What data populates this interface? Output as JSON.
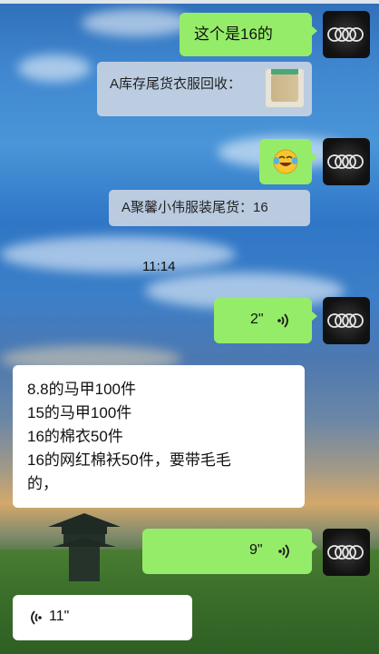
{
  "chat": {
    "messages": [
      {
        "side": "right",
        "type": "text",
        "text": "这个是16的"
      },
      {
        "side": "right",
        "type": "quote",
        "text": "A库存尾货衣服回收："
      },
      {
        "side": "right",
        "type": "emoji",
        "text": ""
      },
      {
        "side": "right",
        "type": "quote",
        "text": "A聚馨小伟服装尾货：16"
      },
      {
        "side": "center",
        "type": "time",
        "text": "11:14"
      },
      {
        "side": "right",
        "type": "voice",
        "text": "2\""
      },
      {
        "side": "left",
        "type": "text",
        "lines": [
          "8.8的马甲100件",
          "15的马甲100件",
          "16的棉衣50件",
          "16的网红棉袄50件，要带毛毛",
          "的，"
        ]
      },
      {
        "side": "right",
        "type": "voice",
        "text": "9\""
      },
      {
        "side": "left",
        "type": "voice",
        "text": "11\""
      }
    ]
  },
  "colors": {
    "sent_bubble": "#95ec69",
    "received_bubble": "#ffffff",
    "quote_bubble": "#cdd6e2"
  },
  "icons": {
    "avatar": "audi-rings-avatar",
    "voice": "voice-wave-icon",
    "emoji": "laughing-tears-emoji"
  }
}
